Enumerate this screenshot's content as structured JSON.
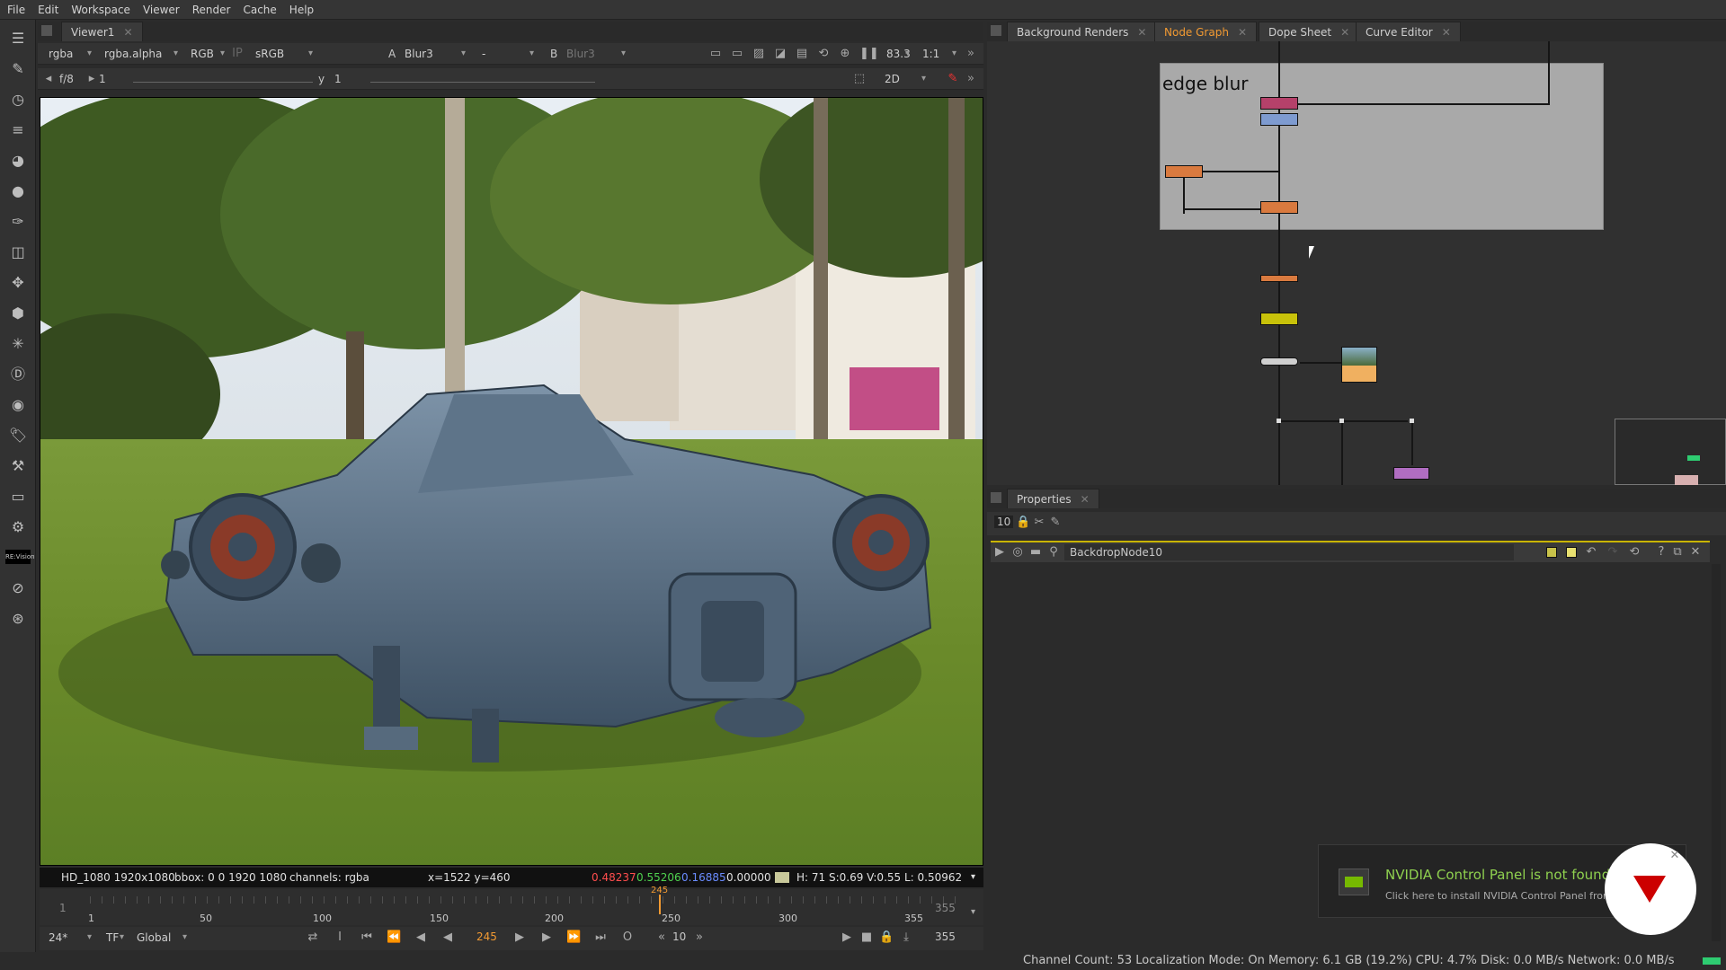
{
  "menu": [
    "File",
    "Edit",
    "Workspace",
    "Viewer",
    "Render",
    "Cache",
    "Help"
  ],
  "viewer": {
    "tab_label": "Viewer1",
    "channels": "rgba",
    "alpha_channel": "rgba.alpha",
    "display": "RGB",
    "colorspace": "sRGB",
    "input_a_label": "A",
    "input_a": "Blur3",
    "wipe_op": "-",
    "input_b_label": "B",
    "input_b": "Blur3",
    "zoom_value": "83.3",
    "proxy_ratio": "1:1",
    "fstop": "f/8",
    "gain_value": "1",
    "gamma_label": "y",
    "gamma_value": "1",
    "view_mode": "2D"
  },
  "info_bar": {
    "format": "HD_1080 1920x1080",
    "bbox": "bbox: 0 0 1920 1080",
    "channels": "channels: rgba",
    "coords": "x=1522 y=460",
    "r": "0.48237",
    "g": "0.55206",
    "b": "0.16885",
    "a": "0.00000",
    "hsvl": "H: 71 S:0.69 V:0.55  L: 0.50962"
  },
  "timeline": {
    "start": "1",
    "end": "355",
    "current": "245",
    "ticks": [
      "1",
      "50",
      "100",
      "150",
      "200",
      "250",
      "300",
      "355"
    ]
  },
  "transport": {
    "fps": "24*",
    "tf": "TF",
    "scope": "Global",
    "frame": "245",
    "step": "10",
    "end_frame": "355"
  },
  "right_tabs": [
    {
      "label": "Background Renders",
      "active": false
    },
    {
      "label": "Node Graph",
      "active": true
    },
    {
      "label": "Dope Sheet",
      "active": false
    },
    {
      "label": "Curve Editor",
      "active": false
    }
  ],
  "node_graph": {
    "backdrop_label": "edge blur",
    "colors": {
      "backdrop": "#a9a9a9",
      "merge": "#b5416a",
      "grade": "#7e9bd0",
      "blur": "#d97a3f",
      "yellow": "#c8c20a",
      "dot_gray": "#cfcfcf",
      "read": "#f0b060",
      "purple": "#b06dc1"
    }
  },
  "properties": {
    "tab_label": "Properties",
    "max_panels": "10",
    "node_name": "BackdropNode10"
  },
  "notification": {
    "title": "NVIDIA Control Panel is not found",
    "subtitle": "Click here to install NVIDIA Control Panel from Mic"
  },
  "status_bar": "Channel Count: 53 Localization Mode: On Memory: 6.1 GB (19.2%) CPU: 4.7% Disk: 0.0 MB/s Network: 0.0 MB/s"
}
